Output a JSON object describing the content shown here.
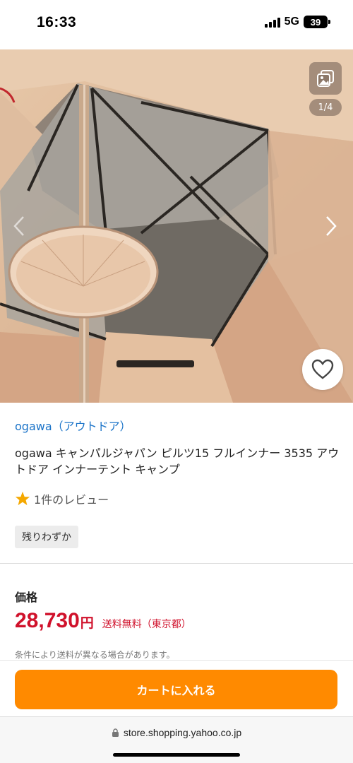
{
  "status_bar": {
    "time": "16:33",
    "network": "5G",
    "battery": "39"
  },
  "gallery": {
    "counter": "1/4",
    "icons": {
      "gallery": "images-stack-icon",
      "prev": "chevron-left-icon",
      "next": "chevron-right-icon",
      "favorite": "heart-outline-icon"
    }
  },
  "product": {
    "brand": "ogawa（アウトドア）",
    "title": "ogawa キャンパルジャパン ピルツ15 フルインナー 3535 アウトドア インナーテント キャンプ",
    "review_text": "1件のレビュー",
    "stock_badge": "残りわずか",
    "price_label": "価格",
    "price": "28,730",
    "currency": "円",
    "shipping": "送料無料（東京都）",
    "shipping_note": "条件により送料が異なる場合があります。"
  },
  "cart": {
    "button_label": "カートに入れる"
  },
  "browser": {
    "url": "store.shopping.yahoo.co.jp"
  },
  "colors": {
    "link": "#1a73c8",
    "price": "#d0112b",
    "cart_button": "#ff8a00",
    "star": "#f5a800"
  }
}
